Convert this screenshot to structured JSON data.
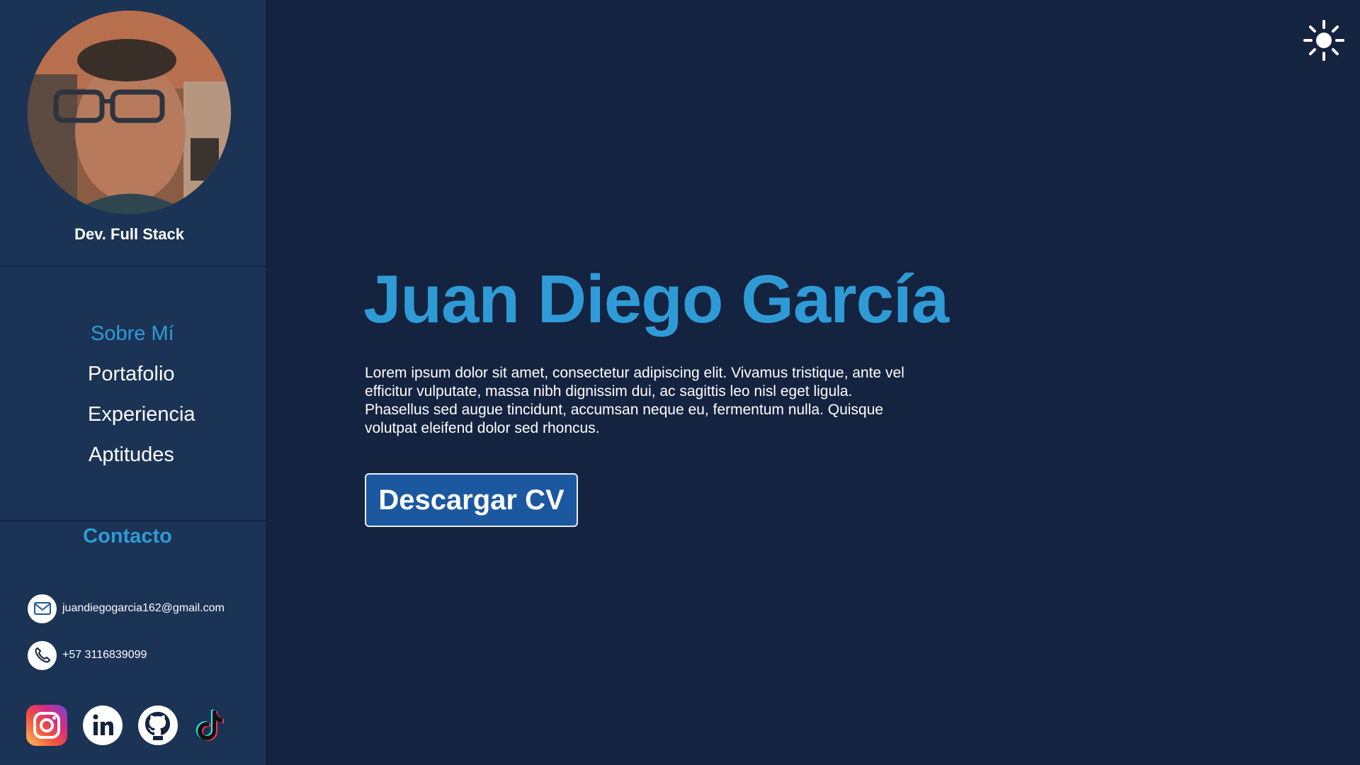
{
  "sidebar": {
    "role": "Dev. Full Stack",
    "nav": [
      {
        "label": "Sobre Mí",
        "active": true
      },
      {
        "label": "Portafolio",
        "active": false
      },
      {
        "label": "Experiencia",
        "active": false
      },
      {
        "label": "Aptitudes",
        "active": false
      }
    ],
    "contact_title": "Contacto",
    "email": "juandiegogarcia162@gmail.com",
    "phone": "+57 3116839099",
    "social": [
      "instagram-icon",
      "linkedin-icon",
      "github-icon",
      "tiktok-icon"
    ]
  },
  "main": {
    "title": "Juan Diego García",
    "description": "Lorem ipsum dolor sit amet, consectetur adipiscing elit. Vivamus tristique, ante vel efficitur vulputate, massa nibh dignissim dui, ac sagittis leo nisl eget ligula. Phasellus sed augue tincidunt, accumsan neque eu, fermentum nulla. Quisque volutpat eleifend dolor sed rhoncus.",
    "cv_button": "Descargar CV"
  },
  "theme_toggle_icon": "sun-icon",
  "colors": {
    "background": "#14233f",
    "sidebar": "#1b3355",
    "accent": "#2f9bd6",
    "button": "#1c58a0"
  }
}
